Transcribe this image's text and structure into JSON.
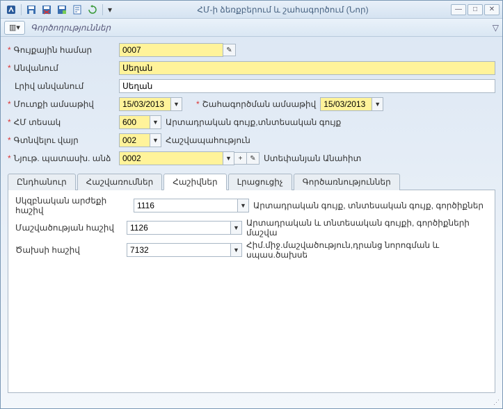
{
  "title": "ՀՄ-ի ձեռքբերում և շահագործում (Նոր)",
  "subbar": {
    "label": "Գործողություններ"
  },
  "labels": {
    "inventory_number": "Գույքային համար",
    "name": "Անվանում",
    "full_name": "Լրիվ անվանում",
    "entry_date": "Մուտքի ամսաթիվ",
    "exploit_date": "Շահագործման ամսաթիվ",
    "type": "ՀՄ տեսակ",
    "location": "Գտնվելու վայր",
    "responsible": "Նյութ. պատասխ. անձ"
  },
  "fields": {
    "inventory_number": "0007",
    "name": "Սեղան",
    "full_name": "Սեղան",
    "entry_date": "15/03/2013",
    "exploit_date": "15/03/2013",
    "type": "600",
    "type_desc": "Արտադրական գույք,տնտեսական գույք",
    "location": "002",
    "location_desc": "Հաշվապահություն",
    "responsible": "0002",
    "responsible_desc": "Ստեփանյան Անահիտ"
  },
  "tabs": {
    "t1": "Ընդհանուր",
    "t2": "Հաշվառումներ",
    "t3": "Հաշիվներ",
    "t4": "Լրացուցիչ",
    "t5": "Գործառնություններ"
  },
  "accounts": {
    "l1": "Սկզբնական արժեքի հաշիվ",
    "v1": "1116",
    "d1": "Արտադրական գույք, տնտեսական գույք, գործիքներ",
    "l2": "Մաշվածության հաշիվ",
    "v2": "1126",
    "d2": "Արտադրական և տնտեսական գույքի, գործիքների մաշվա",
    "l3": "Ծախսի հաշիվ",
    "v3": "7132",
    "d3": "Հիմ.միջ.մաշվածություն,դրանց նորոգման և սպաս.ծախսե"
  }
}
